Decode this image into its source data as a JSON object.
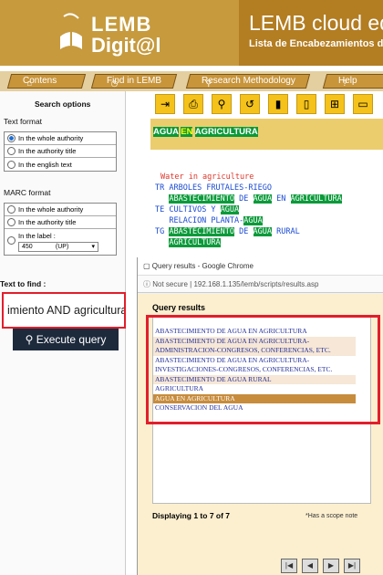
{
  "header": {
    "logo_line1": "LEMB",
    "logo_line2": "Digit@l",
    "cloud_title": "LEMB cloud edi",
    "subtitle": "Lista de Encabezamientos de Ma"
  },
  "nav": {
    "tabs": [
      {
        "label": "Contens",
        "icon": "house-icon"
      },
      {
        "label": "Find in LEMB",
        "icon": "clock-icon"
      },
      {
        "label": "Research Methodology",
        "icon": "search-icon"
      },
      {
        "label": "Help",
        "icon": "question-icon"
      }
    ]
  },
  "search_options": {
    "heading": "Search options",
    "text_format_label": "Text format",
    "text_format_options": [
      "In the whole authority",
      "In the authority title",
      "In the english text"
    ],
    "text_format_selected": 0,
    "marc_label": "MARC format",
    "marc_options": [
      "In the whole authority",
      "In the authority title",
      "In the label :"
    ],
    "label_value": "450",
    "label_option": "(UP)",
    "text_to_find_label": "Text to find :",
    "text_to_find_value": "imiento AND agricultura",
    "execute_label": "Execute query"
  },
  "toolbar": {
    "icons": [
      "export-icon",
      "print-icon",
      "search-icon",
      "history-icon",
      "bookmark-filled-icon",
      "bookmark-outline-icon",
      "folder-add-icon",
      "folder-open-icon"
    ]
  },
  "record": {
    "heading_parts": [
      "AGUA",
      "EN",
      "AGRICULTURA"
    ],
    "english": "Water in agriculture",
    "tr": "TR",
    "tr_line1": "ARBOLES FRUTALES-RIEGO",
    "tr_line2_parts": [
      "ABASTECIMIENTO",
      "DE",
      "AGUA",
      "EN",
      "AGRICULTURA"
    ],
    "te": "TE",
    "te_line1_a": "CULTIVOS Y",
    "te_line1_b": "AGUA",
    "te_line2_a": "RELACION PLANTA-",
    "te_line2_b": "AGUA",
    "tg": "TG",
    "tg_line1_parts": [
      "ABASTECIMIENTO",
      "DE",
      "AGUA",
      "RURAL"
    ],
    "tg_line2": "AGRICULTURA"
  },
  "dialog": {
    "window_title": "Query results - Google Chrome",
    "security": "Not secure",
    "url": "192.168.1.135/lemb/scripts/results.asp",
    "heading": "Query results",
    "results": [
      "ABASTECIMIENTO DE AGUA EN AGRICULTURA",
      "ABASTECIMIENTO DE AGUA EN AGRICULTURA-",
      "ADMINISTRACION-CONGRESOS, CONFERENCIAS, ETC.",
      "ABASTECIMIENTO DE AGUA EN AGRICULTURA-",
      "INVESTIGACIONES-CONGRESOS, CONFERENCIAS, ETC.",
      "ABASTECIMIENTO DE AGUA RURAL",
      "AGRICULTURA",
      "AGUA EN AGRICULTURA",
      "CONSERVACION DEL AGUA"
    ],
    "selected_index": 7,
    "displaying": "Displaying  1 to 7 of 7",
    "scope_note": "*Has a scope note",
    "nav_icons": [
      "first-page-icon",
      "prev-page-icon",
      "next-page-icon",
      "last-page-icon"
    ]
  },
  "colors": {
    "header_bg": "#c69a3d",
    "highlight_green": "#0a9a3a",
    "selected_row": "#c78c3c",
    "accent_red": "#e21e2c"
  }
}
